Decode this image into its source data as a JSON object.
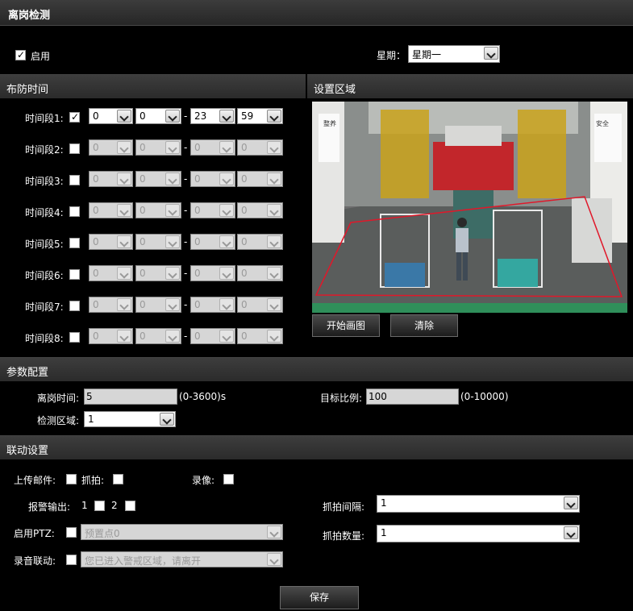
{
  "title": "离岗检测",
  "enable": {
    "label": "启用",
    "checked": true
  },
  "weekday": {
    "label": "星期：",
    "value": "星期一"
  },
  "schedule": {
    "header": "布防时间",
    "dash": "-",
    "periods": [
      {
        "label": "时间段1:",
        "checked": true,
        "start_h": "0",
        "start_m": "0",
        "end_h": "23",
        "end_m": "59"
      },
      {
        "label": "时间段2:",
        "checked": false,
        "start_h": "0",
        "start_m": "0",
        "end_h": "0",
        "end_m": "0"
      },
      {
        "label": "时间段3:",
        "checked": false,
        "start_h": "0",
        "start_m": "0",
        "end_h": "0",
        "end_m": "0"
      },
      {
        "label": "时间段4:",
        "checked": false,
        "start_h": "0",
        "start_m": "0",
        "end_h": "0",
        "end_m": "0"
      },
      {
        "label": "时间段5:",
        "checked": false,
        "start_h": "0",
        "start_m": "0",
        "end_h": "0",
        "end_m": "0"
      },
      {
        "label": "时间段6:",
        "checked": false,
        "start_h": "0",
        "start_m": "0",
        "end_h": "0",
        "end_m": "0"
      },
      {
        "label": "时间段7:",
        "checked": false,
        "start_h": "0",
        "start_m": "0",
        "end_h": "0",
        "end_m": "0"
      },
      {
        "label": "时间段8:",
        "checked": false,
        "start_h": "0",
        "start_m": "0",
        "end_h": "0",
        "end_m": "0"
      }
    ]
  },
  "region": {
    "header": "设置区域",
    "start_draw": "开始画图",
    "clear": "清除",
    "sign_left": "整养",
    "sign_right": "安全",
    "polygon_color": "#e0182a"
  },
  "params": {
    "header": "参数配置",
    "leave_time_label": "离岗时间:",
    "leave_time_value": "5",
    "leave_time_range": "(0-3600)s",
    "target_ratio_label": "目标比例:",
    "target_ratio_value": "100",
    "target_ratio_range": "(0-10000)",
    "detect_region_label": "检测区域:",
    "detect_region_value": "1"
  },
  "linkage": {
    "header": "联动设置",
    "upload_mail": "上传邮件:",
    "capture": "抓拍:",
    "record": "录像:",
    "alarm_out": "报警输出:",
    "alarm_1": "1",
    "alarm_2": "2",
    "ptz_label": "启用PTZ:",
    "ptz_value": "预置点0",
    "audio_label": "录音联动:",
    "audio_value": "您已进入警戒区域，请离开",
    "interval_label": "抓拍间隔:",
    "interval_value": "1",
    "count_label": "抓拍数量:",
    "count_value": "1"
  },
  "save_label": "保存",
  "colors": {
    "background": "#000000",
    "section": "#333333",
    "polygon": "#e0182a"
  }
}
